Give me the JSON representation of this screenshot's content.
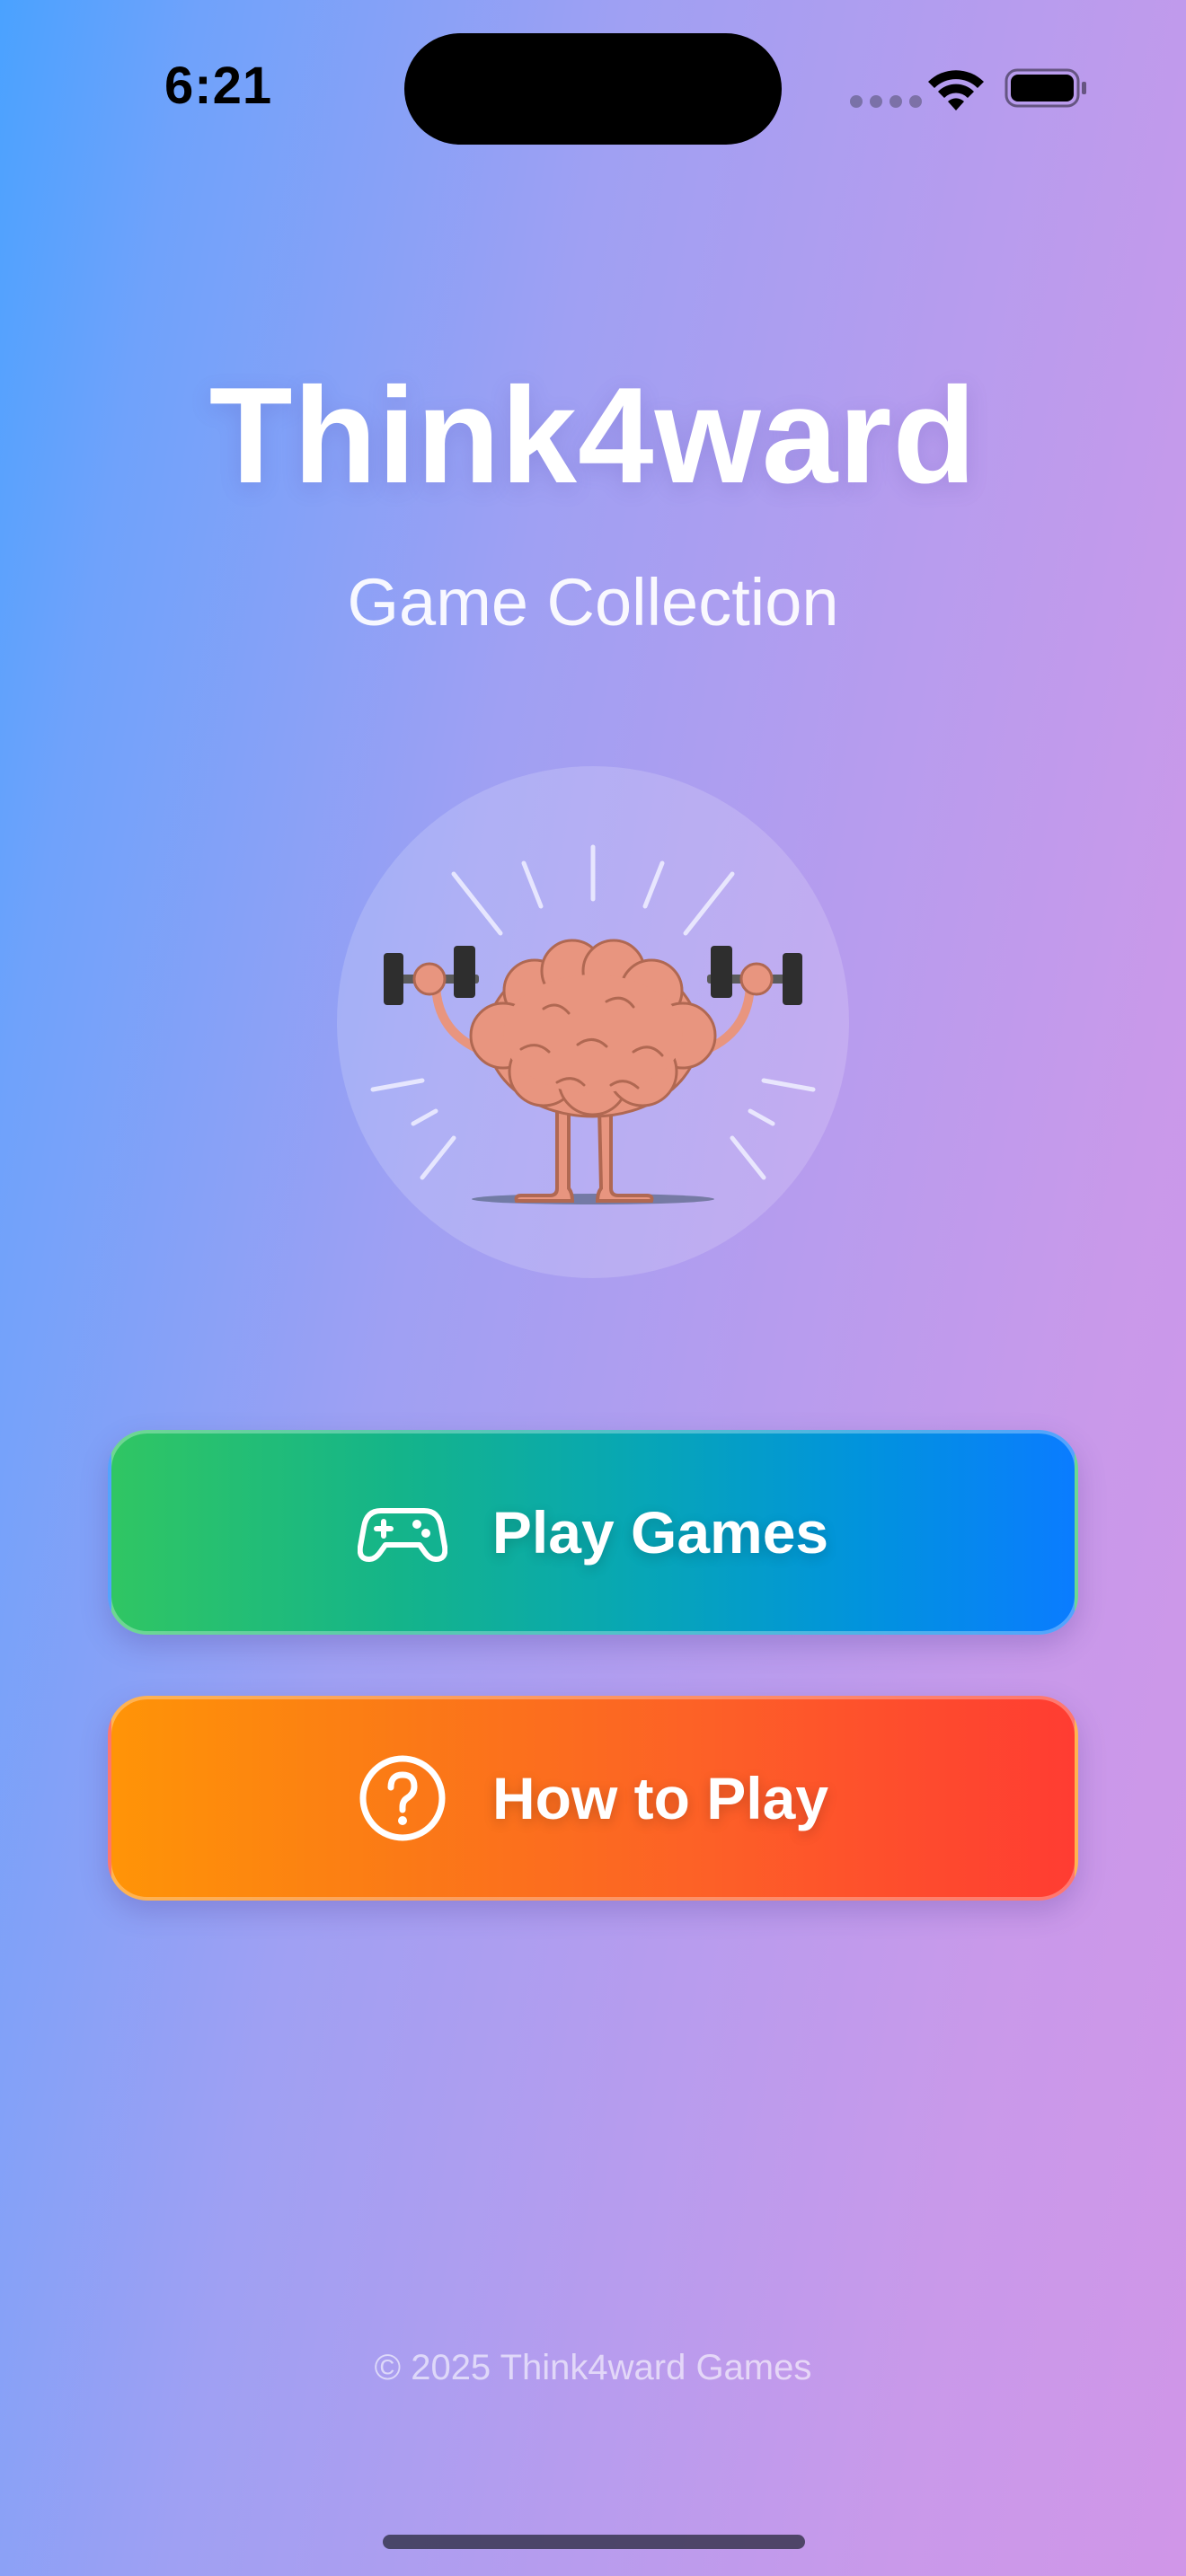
{
  "status_bar": {
    "time": "6:21",
    "icons": [
      "cellular-signal-icon",
      "wifi-icon",
      "battery-icon"
    ]
  },
  "header": {
    "title": "Think4ward",
    "subtitle": "Game Collection"
  },
  "mascot": {
    "description_icon": "brain-lifting-dumbbells-icon"
  },
  "buttons": {
    "play": {
      "label": "Play Games",
      "icon": "gamepad-icon"
    },
    "howto": {
      "label": "How to Play",
      "icon": "question-circle-icon"
    }
  },
  "footer": {
    "text": "© 2025 Think4ward Games"
  },
  "colors": {
    "background_start": "#4aa2ff",
    "background_end": "#d096e8",
    "play_start": "#30c663",
    "play_end": "#0a7cff",
    "howto_start": "#ff9407",
    "howto_end": "#ff3c32",
    "brain": "#e8957f"
  }
}
